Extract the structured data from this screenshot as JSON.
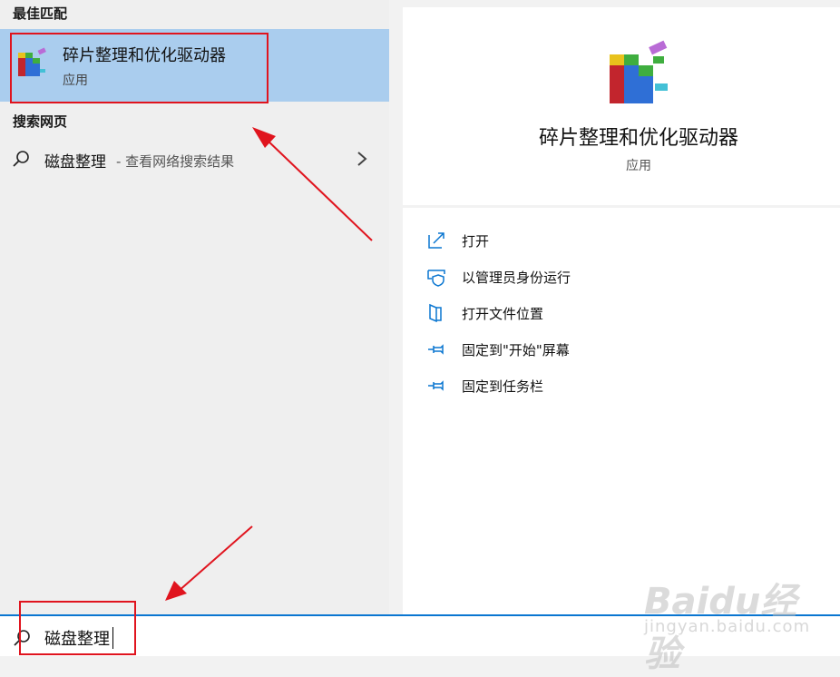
{
  "left_pane": {
    "best_match_header": "最佳匹配",
    "best_match": {
      "title": "碎片整理和优化驱动器",
      "subtitle": "应用",
      "icon": "defrag-app-icon"
    },
    "web_header": "搜索网页",
    "web_result": {
      "query": "磁盘整理",
      "description": "- 查看网络搜索结果",
      "icon": "search-icon",
      "chevron": "chevron-right-icon"
    }
  },
  "detail": {
    "title": "碎片整理和优化驱动器",
    "subtitle": "应用",
    "icon": "defrag-app-icon",
    "actions": [
      {
        "label": "打开",
        "icon": "open-icon"
      },
      {
        "label": "以管理员身份运行",
        "icon": "shield-icon"
      },
      {
        "label": "打开文件位置",
        "icon": "file-location-icon"
      },
      {
        "label": "固定到\"开始\"屏幕",
        "icon": "pin-icon"
      },
      {
        "label": "固定到任务栏",
        "icon": "pin-icon"
      }
    ]
  },
  "search": {
    "value": "磁盘整理",
    "icon": "search-icon"
  },
  "watermark": {
    "brand": "Baidu经验",
    "sub": "jingyan.baidu.com"
  },
  "colors": {
    "accent": "#0a76d1",
    "selected": "#aacdee",
    "annotation": "#e0141e"
  }
}
